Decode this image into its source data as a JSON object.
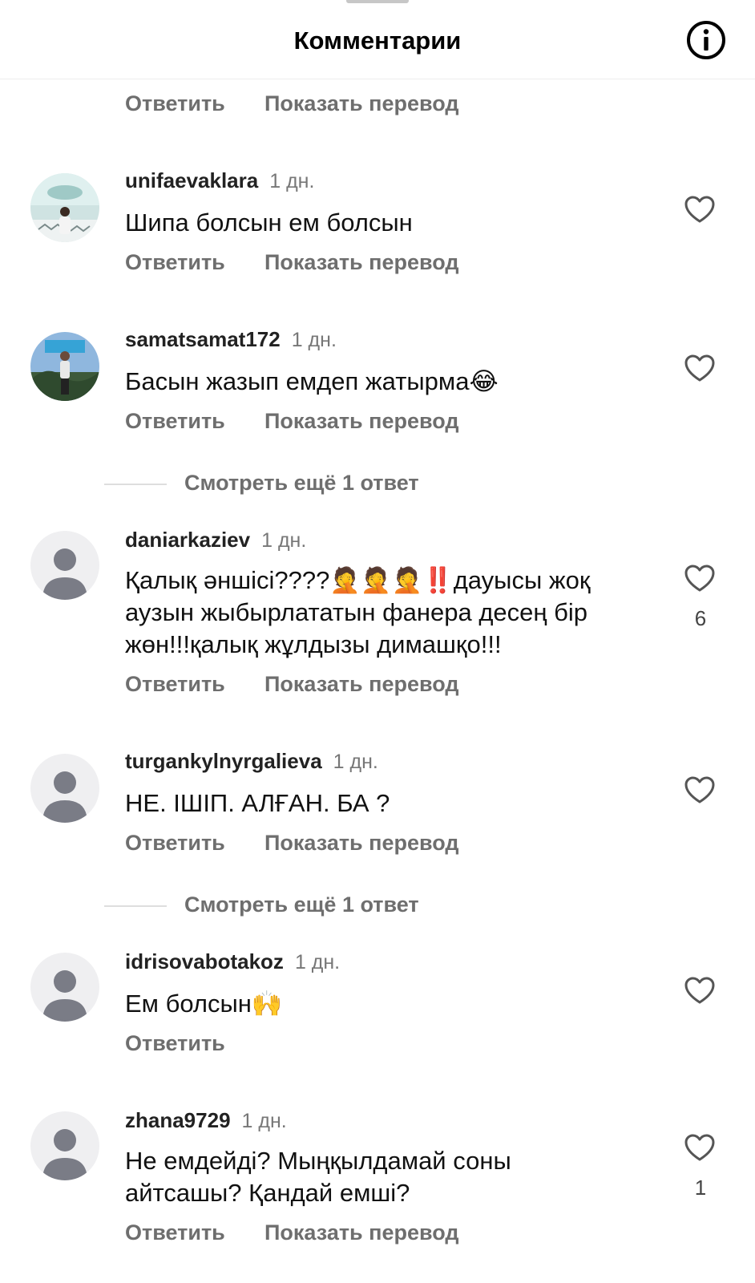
{
  "header": {
    "title": "Комментарии"
  },
  "labels": {
    "reply": "Ответить",
    "translate": "Показать перевод",
    "view_more": "Смотреть ещё 1 ответ"
  },
  "comments": [
    {
      "user": "unifaevaklara",
      "time": "1 дн.",
      "text": "Шипа болсын ем болсын",
      "likes": ""
    },
    {
      "user": "samatsamat172",
      "time": "1 дн.",
      "text": "Басын жазып емдеп жатырма😂",
      "likes": ""
    },
    {
      "user": "daniarkaziev",
      "time": "1 дн.",
      "text": "Қалық әншісі????🤦🤦🤦‼️дауысы жоқ аузын жыбырлататын фанера десең бір жөн!!!қалық жұлдызы димашқо!!!",
      "likes": "6"
    },
    {
      "user": "turgankylnyrgalieva",
      "time": "1 дн.",
      "text": "НЕ. ІШІП. АЛҒАН. БА ?",
      "likes": ""
    },
    {
      "user": "idrisovabotakoz",
      "time": "1 дн.",
      "text": "Ем болсын🙌",
      "likes": ""
    },
    {
      "user": "zhana9729",
      "time": "1 дн.",
      "text": "Не емдейді? Мыңқылдамай соны айтсашы? Қандай емші?",
      "likes": "1"
    }
  ],
  "icons": {
    "info": "info-icon",
    "like": "heart-icon",
    "avatar_default": "default-avatar-icon"
  }
}
